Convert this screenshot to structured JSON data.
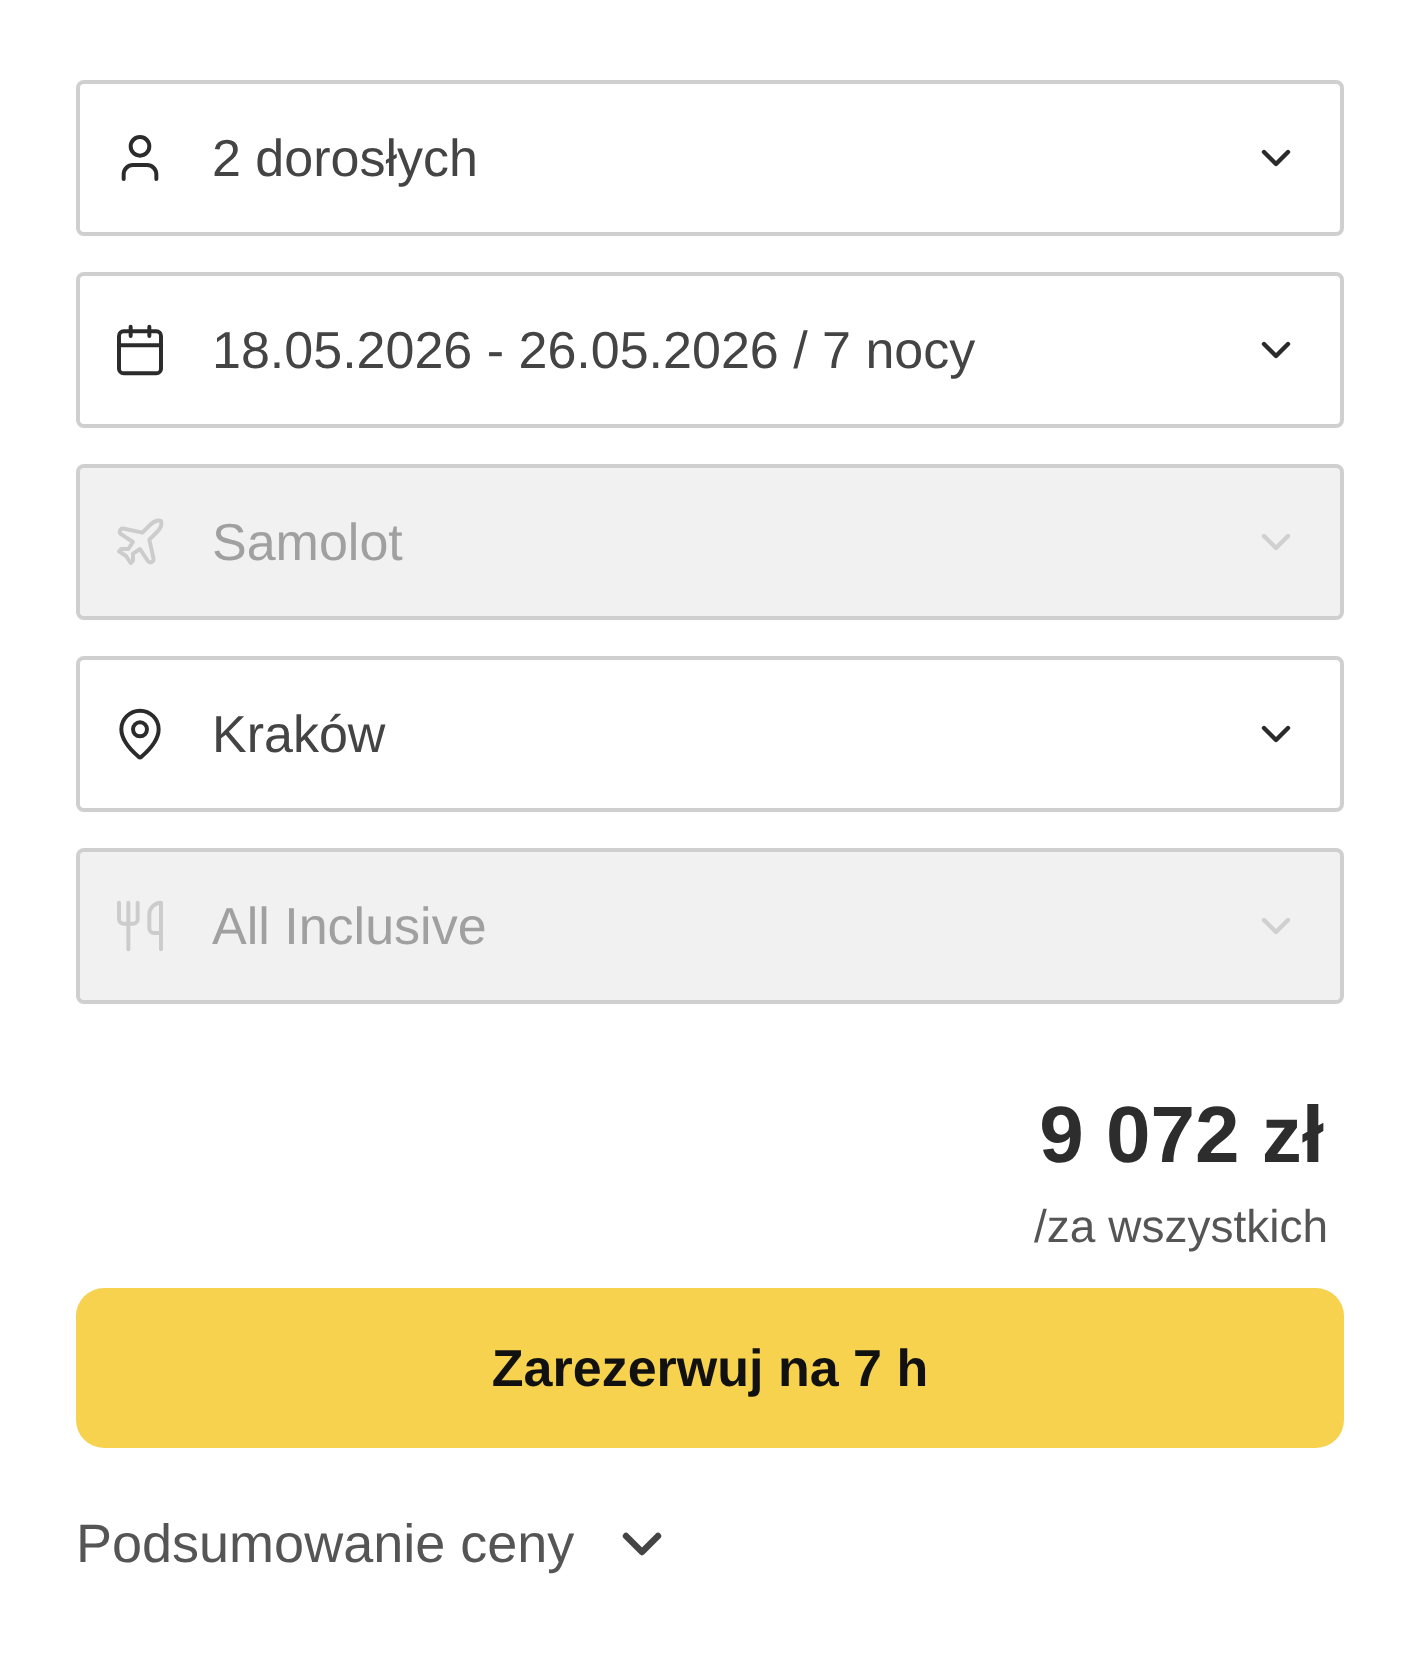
{
  "fields": [
    {
      "kind": "travelers",
      "value": "2 dorosłych",
      "disabled": false
    },
    {
      "kind": "dates",
      "value": "18.05.2026 - 26.05.2026 / 7 nocy",
      "disabled": false
    },
    {
      "kind": "transport",
      "value": "Samolot",
      "disabled": true
    },
    {
      "kind": "departure",
      "value": "Kraków",
      "disabled": false
    },
    {
      "kind": "board",
      "value": "All Inclusive",
      "disabled": true
    }
  ],
  "price": {
    "amount": "9 072 zł",
    "note": "/za wszystkich"
  },
  "book_button": {
    "label": "Zarezerwuj na 7 h"
  },
  "summary": {
    "label": "Podsumowanie ceny",
    "expanded": false
  }
}
